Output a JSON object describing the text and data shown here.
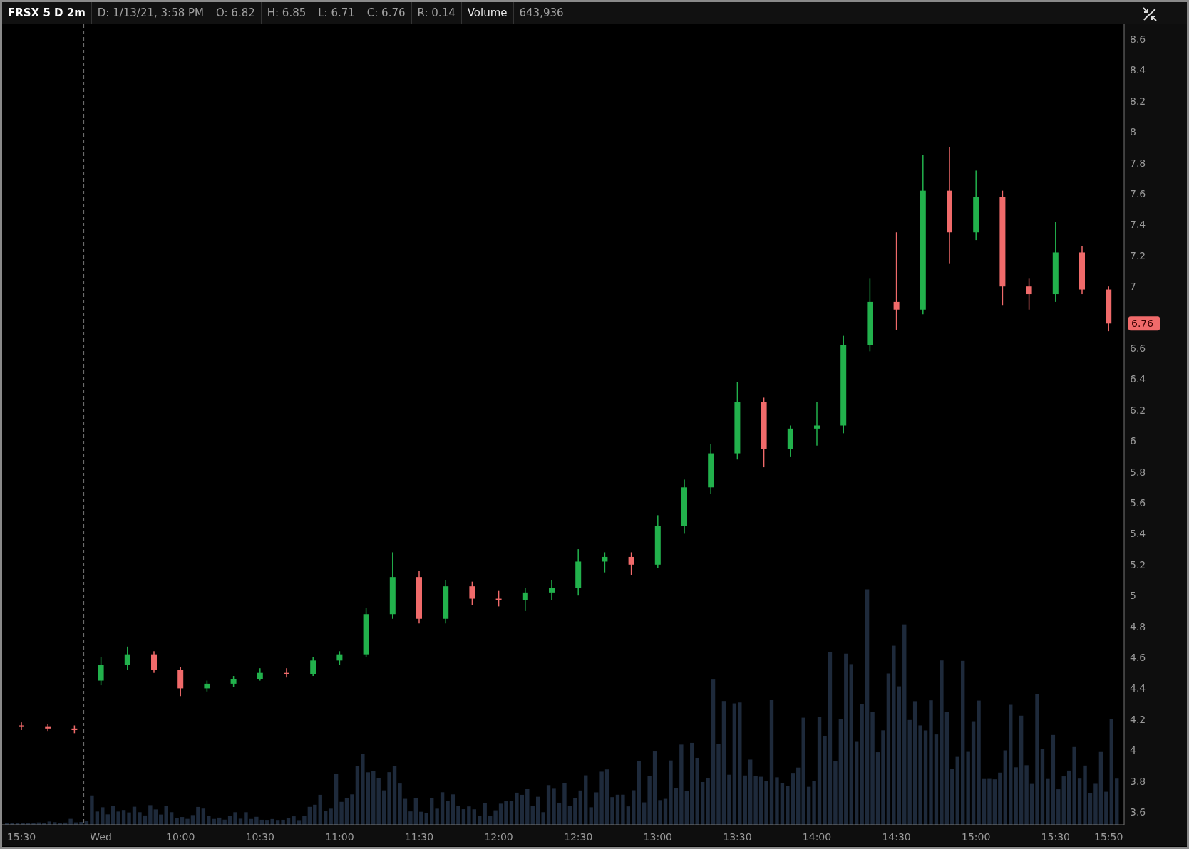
{
  "header": {
    "symbol": "FRSX 5 D 2m",
    "fields": [
      {
        "kind": "value",
        "text": "D: 1/13/21, 3:58 PM"
      },
      {
        "kind": "value",
        "text": "O: 6.82"
      },
      {
        "kind": "value",
        "text": "H: 6.85"
      },
      {
        "kind": "value",
        "text": "L: 6.71"
      },
      {
        "kind": "value",
        "text": "C: 6.76"
      },
      {
        "kind": "value",
        "text": "R: 0.14"
      },
      {
        "kind": "label",
        "text": "Volume"
      },
      {
        "kind": "value",
        "text": "643,936"
      }
    ]
  },
  "price_chart": {
    "last_price_tag": "6.76",
    "chart_data": {
      "type": "candlestick",
      "categories": [
        "15:30",
        null,
        null,
        "Wed",
        null,
        null,
        "10:00",
        null,
        null,
        "10:30",
        null,
        null,
        "11:00",
        null,
        null,
        "11:30",
        null,
        null,
        "12:00",
        null,
        null,
        "12:30",
        null,
        null,
        "13:00",
        null,
        null,
        "13:30",
        null,
        null,
        "14:00",
        null,
        null,
        "14:30",
        null,
        null,
        "15:00",
        null,
        null,
        "15:30",
        null,
        "15:50"
      ],
      "ohlc": [
        [
          4.16,
          4.18,
          4.13,
          4.15
        ],
        [
          4.15,
          4.17,
          4.12,
          4.14
        ],
        [
          4.14,
          4.16,
          4.11,
          4.13
        ],
        [
          4.45,
          4.6,
          4.42,
          4.55
        ],
        [
          4.55,
          4.67,
          4.52,
          4.62
        ],
        [
          4.62,
          4.64,
          4.5,
          4.52
        ],
        [
          4.52,
          4.54,
          4.35,
          4.4
        ],
        [
          4.4,
          4.45,
          4.38,
          4.43
        ],
        [
          4.43,
          4.48,
          4.41,
          4.46
        ],
        [
          4.46,
          4.53,
          4.45,
          4.5
        ],
        [
          4.5,
          4.53,
          4.47,
          4.49
        ],
        [
          4.49,
          4.6,
          4.48,
          4.58
        ],
        [
          4.58,
          4.64,
          4.55,
          4.62
        ],
        [
          4.62,
          4.92,
          4.6,
          4.88
        ],
        [
          4.88,
          5.28,
          4.85,
          5.12
        ],
        [
          5.12,
          5.16,
          4.82,
          4.85
        ],
        [
          4.85,
          5.1,
          4.82,
          5.06
        ],
        [
          5.06,
          5.09,
          4.94,
          4.98
        ],
        [
          4.98,
          5.03,
          4.93,
          4.97
        ],
        [
          4.97,
          5.05,
          4.9,
          5.02
        ],
        [
          5.02,
          5.1,
          4.97,
          5.05
        ],
        [
          5.05,
          5.3,
          5.0,
          5.22
        ],
        [
          5.22,
          5.28,
          5.15,
          5.25
        ],
        [
          5.25,
          5.28,
          5.13,
          5.2
        ],
        [
          5.2,
          5.52,
          5.18,
          5.45
        ],
        [
          5.45,
          5.75,
          5.4,
          5.7
        ],
        [
          5.7,
          5.98,
          5.66,
          5.92
        ],
        [
          5.92,
          6.38,
          5.88,
          6.25
        ],
        [
          6.25,
          6.28,
          5.83,
          5.95
        ],
        [
          5.95,
          6.1,
          5.9,
          6.08
        ],
        [
          6.08,
          6.25,
          5.97,
          6.1
        ],
        [
          6.1,
          6.68,
          6.05,
          6.62
        ],
        [
          6.62,
          7.05,
          6.58,
          6.9
        ],
        [
          6.9,
          7.35,
          6.72,
          6.85
        ],
        [
          6.85,
          7.85,
          6.82,
          7.62
        ],
        [
          7.62,
          7.9,
          7.15,
          7.35
        ],
        [
          7.35,
          7.75,
          7.3,
          7.58
        ],
        [
          7.58,
          7.62,
          6.88,
          7.0
        ],
        [
          7.0,
          7.05,
          6.85,
          6.95
        ],
        [
          6.95,
          7.42,
          6.9,
          7.22
        ],
        [
          7.22,
          7.26,
          6.95,
          6.98
        ],
        [
          6.98,
          7.0,
          6.71,
          6.76
        ]
      ],
      "ylim": [
        3.52,
        8.7
      ],
      "yticks": [
        8.6,
        8.4,
        8.2,
        8,
        7.8,
        7.6,
        7.4,
        7.2,
        7,
        6.6,
        6.4,
        6.2,
        6,
        5.8,
        5.6,
        5.4,
        5.2,
        5,
        4.8,
        4.6,
        4.4,
        4.2,
        4,
        3.8,
        3.6
      ]
    }
  }
}
